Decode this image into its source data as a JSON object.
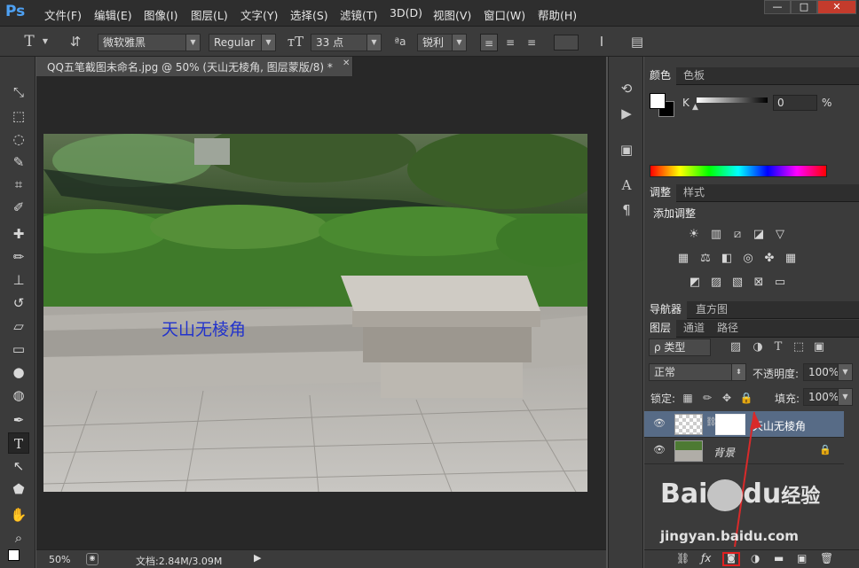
{
  "app": {
    "logo": "Ps"
  },
  "menu": [
    "文件(F)",
    "编辑(E)",
    "图像(I)",
    "图层(L)",
    "文字(Y)",
    "选择(S)",
    "滤镜(T)",
    "3D(D)",
    "视图(V)",
    "窗口(W)",
    "帮助(H)"
  ],
  "window_controls": [
    "—",
    "□",
    "✕"
  ],
  "options": {
    "tool_glyph": "T",
    "font_family": "微软雅黑",
    "font_style": "Regular",
    "font_size": "33 点",
    "aa_label": "ªa",
    "antialias": "锐利"
  },
  "document": {
    "tab_title": "QQ五笔截图未命名.jpg @ 50% (天山无棱角, 图层蒙版/8) *",
    "close": "✕",
    "canvas_text": "天山无棱角"
  },
  "status": {
    "zoom": "50%",
    "doc_info": "文档:2.84M/3.09M"
  },
  "color_panel": {
    "tabs": [
      "颜色",
      "色板"
    ],
    "channel": "K",
    "value": "0",
    "unit": "%"
  },
  "adjust_panel": {
    "tabs": [
      "调整",
      "样式"
    ],
    "title": "添加调整"
  },
  "nav_panel": {
    "tabs": [
      "导航器",
      "直方图"
    ]
  },
  "layers_panel": {
    "tabs": [
      "图层",
      "通道",
      "路径"
    ],
    "filter_label": "ρ 类型",
    "blend_mode": "正常",
    "opacity_label": "不透明度:",
    "opacity": "100%",
    "lock_label": "锁定:",
    "fill_label": "填充:",
    "fill": "100%",
    "layers": [
      {
        "name": "天山无棱角",
        "selected": true
      },
      {
        "name": "背景",
        "selected": false
      }
    ]
  },
  "watermark": {
    "brand": "Bai",
    "brand2": "du",
    "brand_cn": "经验",
    "url": "jingyan.baidu.com"
  }
}
